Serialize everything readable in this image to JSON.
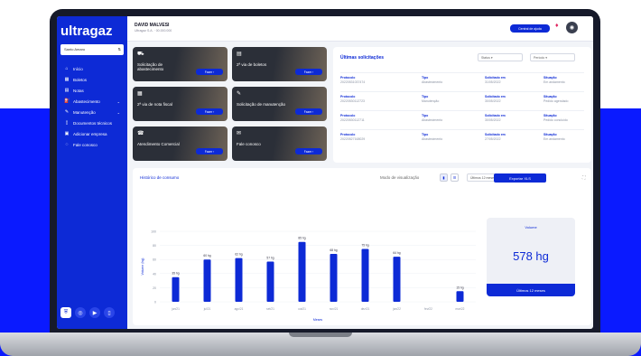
{
  "app": {
    "brand": "ultragaz"
  },
  "user": {
    "name": "DAVID MALVESI",
    "subtitle": "Ultragaz S.A. · 00.000.000"
  },
  "sidebar": {
    "selector": "Santo Amaro",
    "items": [
      {
        "label": "Início",
        "icon": "home-icon",
        "glyph": "⌂"
      },
      {
        "label": "Boletos",
        "icon": "barcode-icon",
        "glyph": "▦"
      },
      {
        "label": "Notas",
        "icon": "document-icon",
        "glyph": "▤"
      },
      {
        "label": "Abastecimento",
        "icon": "fuel-icon",
        "glyph": "⛽",
        "expandable": true
      },
      {
        "label": "Manutenção",
        "icon": "wrench-icon",
        "glyph": "✎",
        "expandable": true
      },
      {
        "label": "Documentos técnicos",
        "icon": "file-icon",
        "glyph": "▯"
      },
      {
        "label": "Adicionar empresa",
        "icon": "building-icon",
        "glyph": "▣"
      },
      {
        "label": "Fale conosco",
        "icon": "chat-icon",
        "glyph": "◌"
      }
    ]
  },
  "header": {
    "help_button": "Central de ajuda"
  },
  "cards": [
    {
      "label": "Solicitação de abastecimento",
      "icon": "truck-icon",
      "glyph": "⛟",
      "button": "Fazer ›"
    },
    {
      "label": "2ª via de boletos",
      "icon": "invoice-icon",
      "glyph": "▤",
      "button": "Fazer ›"
    },
    {
      "label": "2ª via de nota fiscal",
      "icon": "receipt-icon",
      "glyph": "▦",
      "button": "Fazer ›"
    },
    {
      "label": "Solicitação de manutenção",
      "icon": "tool-icon",
      "glyph": "✎",
      "button": "Fazer ›"
    },
    {
      "label": "Atendimento Comercial",
      "icon": "headset-icon",
      "glyph": "☎",
      "button": "Fazer ›"
    },
    {
      "label": "Fale conosco",
      "icon": "message-icon",
      "glyph": "✉",
      "button": "Fazer ›"
    }
  ],
  "requests": {
    "title": "Últimas solicitações",
    "filters": [
      "Status",
      "Período"
    ],
    "columns": [
      "Protocolo",
      "Tipo",
      "Solicitado em",
      "Situação"
    ],
    "rows": [
      [
        "20220531037474",
        "Abastecimento",
        "31/05/2022",
        "Em andamento"
      ],
      [
        "20220530112723",
        "Manutenção",
        "30/05/2022",
        "Pedido agendado"
      ],
      [
        "20220530112711",
        "Abastecimento",
        "30/05/2022",
        "Pedido concluído"
      ],
      [
        "20220527168029",
        "Abastecimento",
        "27/05/2022",
        "Em andamento"
      ]
    ]
  },
  "consumption": {
    "title": "Histórico de consumo",
    "mode_label": "Modo de visualização",
    "period": "Últimos 12 meses",
    "export_button": "Exportar XLS",
    "volume_label": "Volume",
    "volume_value": "578 hg",
    "volume_button": "Últimos 12 meses"
  },
  "chart_data": {
    "type": "bar",
    "categories": [
      "jun/21",
      "jul/21",
      "ago/21",
      "set/21",
      "out/21",
      "nov/21",
      "dez/21",
      "jan/22",
      "fev/22",
      "mar/22"
    ],
    "values": [
      35,
      60,
      62,
      57,
      85,
      68,
      75,
      64,
      0,
      15
    ],
    "labels": [
      "35 hg",
      "60 hg",
      "62 hg",
      "57 hg",
      "85 hg",
      "68 hg",
      "75 hg",
      "64 hg",
      "",
      "15 hg"
    ],
    "ylim": [
      0,
      100
    ],
    "ylabel": "Volume (hg)",
    "xlabel": "Meses",
    "yticks": [
      0,
      20,
      40,
      60,
      80,
      100
    ],
    "bar_color": "#0d2ad6"
  },
  "colors": {
    "primary": "#0d2ad6",
    "background_blue": "#0a1aff"
  }
}
